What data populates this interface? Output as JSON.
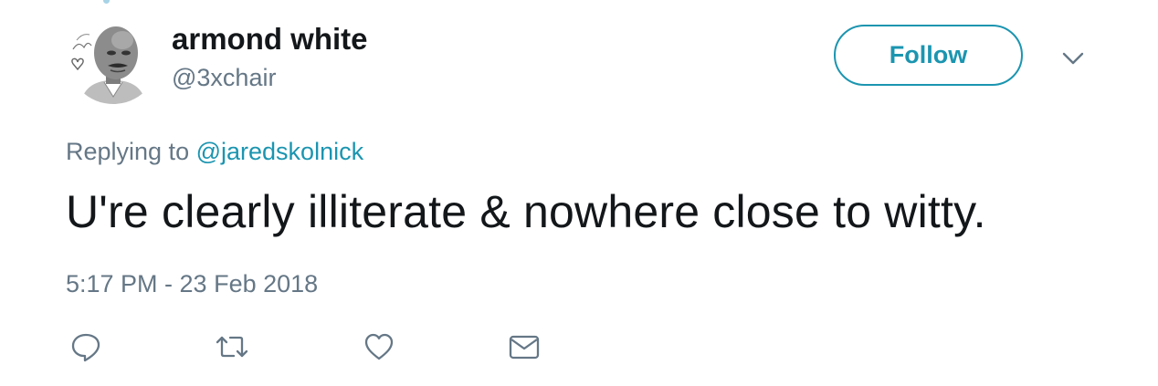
{
  "tweet": {
    "author": {
      "display_name": "armond white",
      "handle": "@3xchair",
      "avatar_icon": "caricature-avatar"
    },
    "follow_label": "Follow",
    "more_icon": "chevron-down-icon",
    "reply_prefix": "Replying to",
    "reply_mention": "@jaredskolnick",
    "text": "U're clearly illiterate & nowhere close to witty.",
    "timestamp": "5:17 PM - 23 Feb 2018",
    "actions": {
      "reply_icon": "reply-icon",
      "retweet_icon": "retweet-icon",
      "like_icon": "heart-icon",
      "dm_icon": "envelope-icon"
    }
  },
  "colors": {
    "accent": "#1b95b0",
    "text": "#14171a",
    "muted": "#657786"
  }
}
